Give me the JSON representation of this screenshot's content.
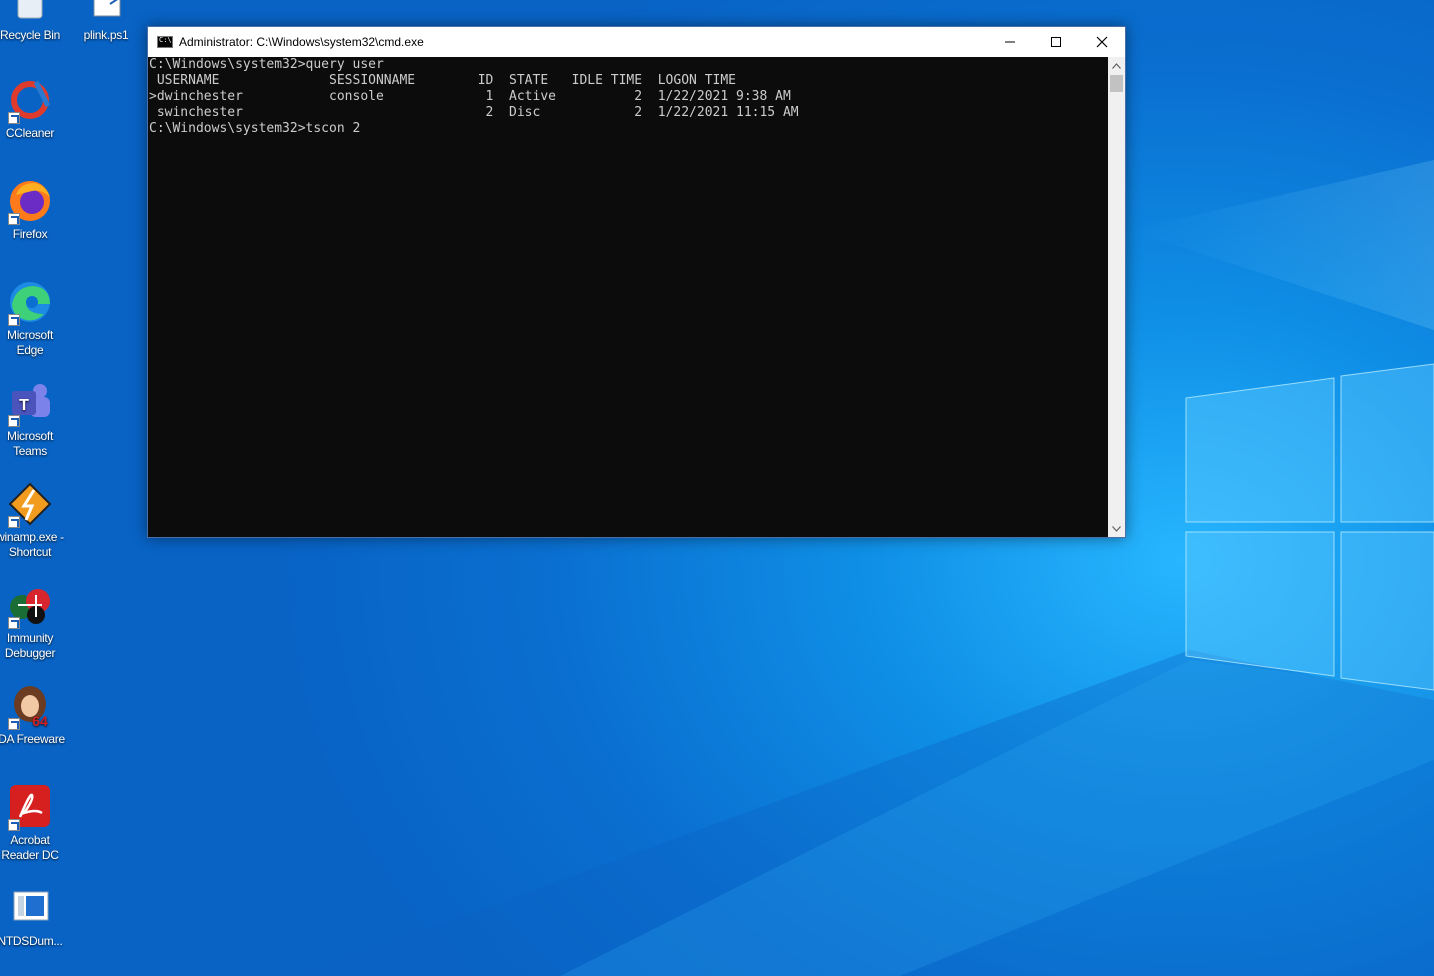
{
  "desktop": {
    "icons": [
      {
        "label": "Recycle Bin",
        "icon": "recycle-bin-icon"
      },
      {
        "label": "plink.ps1",
        "icon": "powershell-script-icon"
      },
      {
        "label": "CCleaner",
        "icon": "ccleaner-icon"
      },
      {
        "label": "Firefox",
        "icon": "firefox-icon"
      },
      {
        "label": "Microsoft\nEdge",
        "icon": "edge-icon"
      },
      {
        "label": "Microsoft\nTeams",
        "icon": "teams-icon"
      },
      {
        "label": "winamp.exe -\nShortcut",
        "icon": "winamp-icon"
      },
      {
        "label": "Immunity\nDebugger",
        "icon": "immunity-debugger-icon"
      },
      {
        "label": "IDA Freeware",
        "icon": "ida-icon"
      },
      {
        "label": "Acrobat\nReader DC",
        "icon": "acrobat-icon"
      },
      {
        "label": "NTDSDum...",
        "icon": "ntdsdump-icon"
      }
    ]
  },
  "window": {
    "title": "Administrator: C:\\Windows\\system32\\cmd.exe",
    "controls": {
      "minimize": "—",
      "maximize": "☐",
      "close": "✕"
    },
    "console_lines": [
      "",
      "C:\\Windows\\system32>query user",
      " USERNAME              SESSIONNAME        ID  STATE   IDLE TIME  LOGON TIME",
      ">dwinchester           console             1  Active          2  1/22/2021 9:38 AM",
      " swinchester                               2  Disc            2  1/22/2021 11:15 AM",
      "",
      "C:\\Windows\\system32>tscon 2"
    ]
  }
}
